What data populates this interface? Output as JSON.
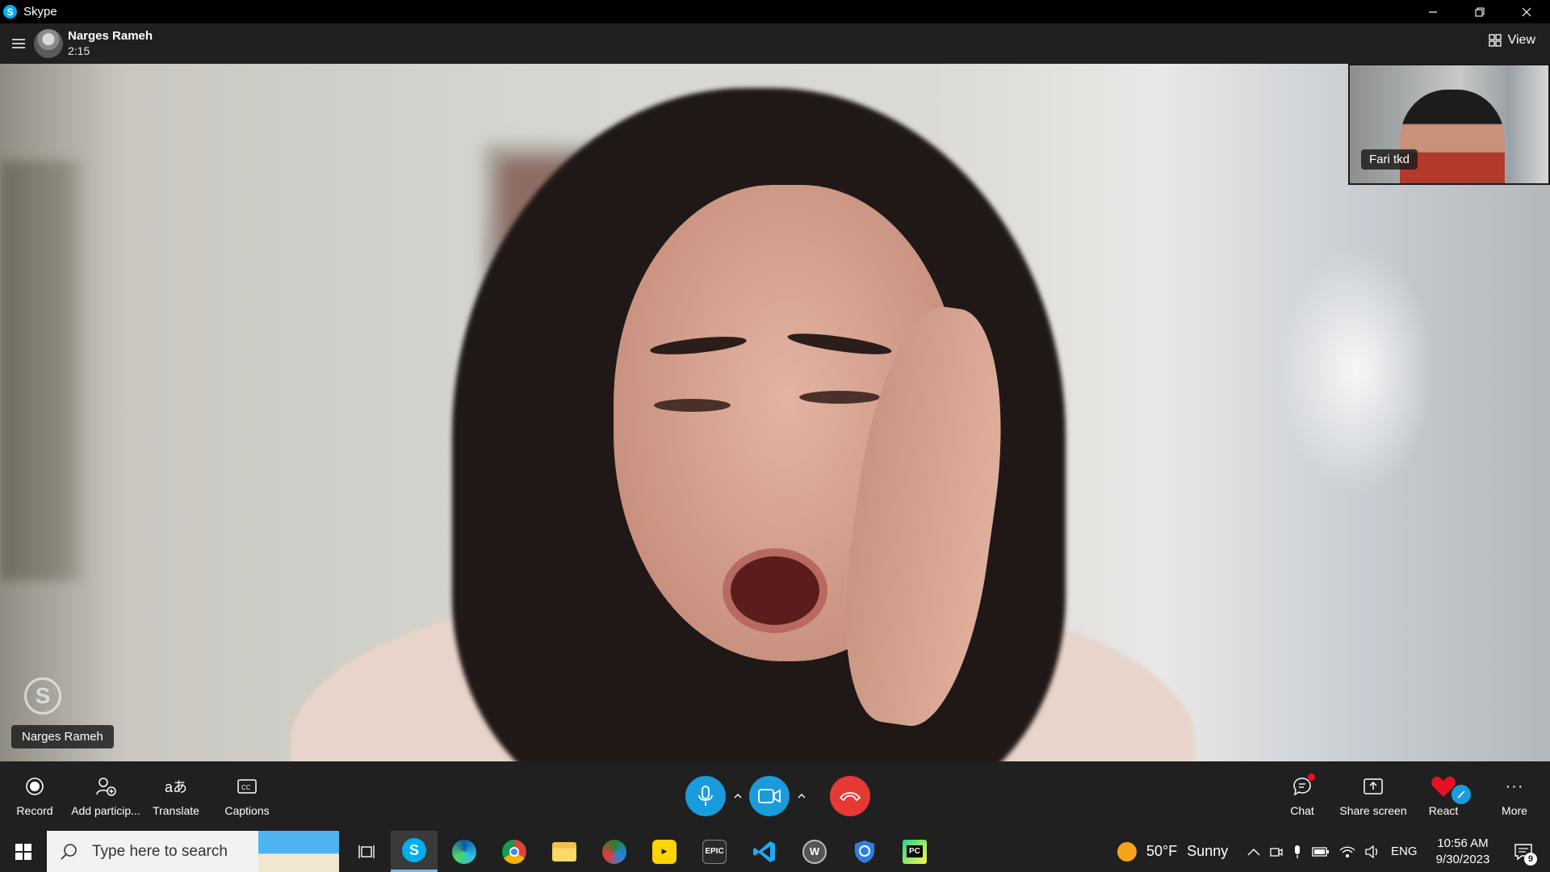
{
  "window": {
    "app_title": "Skype",
    "icons": [
      "skype-icon",
      "minimize-icon",
      "restore-icon",
      "close-icon"
    ]
  },
  "call_header": {
    "contact_name": "Narges Rameh",
    "call_duration": "2:15",
    "view_label": "View"
  },
  "stage": {
    "remote_name_tag": "Narges Rameh",
    "self_view_name": "Fari tkd"
  },
  "controls": {
    "record_label": "Record",
    "add_participants_label": "Add particip...",
    "translate_label": "Translate",
    "captions_label": "Captions",
    "chat_label": "Chat",
    "share_screen_label": "Share screen",
    "react_label": "React",
    "more_label": "More",
    "colors": {
      "mic_active": "#1a9bdc",
      "hangup": "#e53935",
      "react_heart": "#e81123",
      "chat_badge": "#e81123"
    }
  },
  "taskbar": {
    "search_placeholder": "Type here to search",
    "apps": [
      "task-view",
      "skype",
      "edge",
      "chrome",
      "file-explorer",
      "browser-app",
      "kmplayer",
      "epic-games",
      "vscode",
      "wps",
      "security-app",
      "pycharm"
    ],
    "weather_temp": "50°F",
    "weather_condition": "Sunny",
    "language": "ENG",
    "time": "10:56 AM",
    "date": "9/30/2023",
    "notification_count": "9"
  }
}
